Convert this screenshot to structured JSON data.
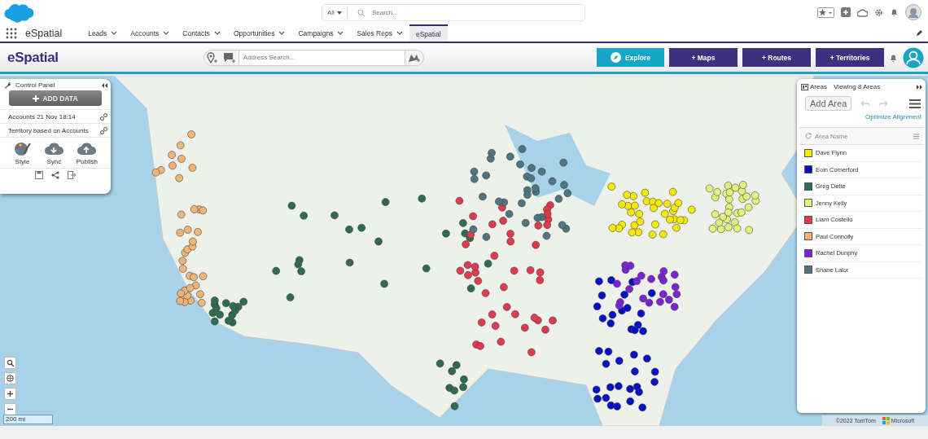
{
  "global_header": {
    "scope": "All",
    "search_placeholder": "Search..."
  },
  "nav": {
    "app_name": "eSpatial",
    "tabs": [
      {
        "label": "Leads",
        "selected": false,
        "has_menu": true
      },
      {
        "label": "Accounts",
        "selected": false,
        "has_menu": true
      },
      {
        "label": "Contacts",
        "selected": false,
        "has_menu": true
      },
      {
        "label": "Opportunities",
        "selected": false,
        "has_menu": true
      },
      {
        "label": "Campaigns",
        "selected": false,
        "has_menu": true
      },
      {
        "label": "Sales Reps",
        "selected": false,
        "has_menu": true
      },
      {
        "label": "eSpatial",
        "selected": true,
        "has_menu": false
      }
    ]
  },
  "toolbar": {
    "logo": "eSpatial",
    "address_placeholder": "Address Search...",
    "buttons": [
      {
        "label": "Explore",
        "kind": "explore"
      },
      {
        "label": "+ Maps",
        "kind": "primary"
      },
      {
        "label": "+ Routes",
        "kind": "primary"
      },
      {
        "label": "+ Territories",
        "kind": "primary"
      }
    ]
  },
  "control_panel": {
    "title": "Control Panel",
    "add_data": "ADD DATA",
    "layers": [
      "Accounts 21 Nov 18:14",
      "Territory based on Accounts"
    ],
    "actions": [
      {
        "label": "Style",
        "kind": "style"
      },
      {
        "label": "Sync",
        "kind": "sync"
      },
      {
        "label": "Publish",
        "kind": "publish"
      }
    ]
  },
  "areas_panel": {
    "title": "Areas",
    "subtitle": "Viewing 8 Areas",
    "add_button": "Add Area",
    "optimize_link": "Optimize Alignment",
    "column": "Area Name",
    "areas": [
      {
        "name": "Dave Flynn",
        "color": "#f5ea00"
      },
      {
        "name": "Eoin Comerford",
        "color": "#0012c4"
      },
      {
        "name": "Greg Dette",
        "color": "#2f6b4f"
      },
      {
        "name": "Jenny Kelly",
        "color": "#e2f27a"
      },
      {
        "name": "Liam Costello",
        "color": "#e03a4c"
      },
      {
        "name": "Paul Connolly",
        "color": "#efb478"
      },
      {
        "name": "Rachel Dunphy",
        "color": "#7a22d6"
      },
      {
        "name": "Shane Lalor",
        "color": "#4f7482"
      }
    ]
  },
  "map": {
    "scale": "200 mi",
    "attribution": "©2022 TomTom",
    "provider": "Microsoft"
  }
}
